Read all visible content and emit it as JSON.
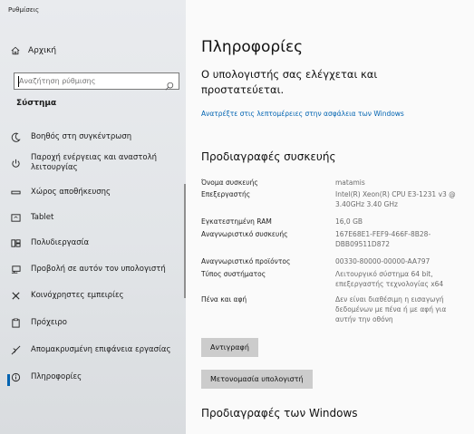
{
  "window": {
    "title": "Ρυθμίσεις"
  },
  "sidebar": {
    "home_label": "Αρχική",
    "search_placeholder": "Αναζήτηση ρύθμισης",
    "section_label": "Σύστημα",
    "items": [
      {
        "label": "Βοηθός στη συγκέντρωση",
        "icon": "moon-icon"
      },
      {
        "label": "Παροχή ενέργειας και αναστολή λειτουργίας",
        "icon": "power-icon"
      },
      {
        "label": "Χώρος αποθήκευσης",
        "icon": "storage-icon"
      },
      {
        "label": "Tablet",
        "icon": "tablet-icon"
      },
      {
        "label": "Πολυδιεργασία",
        "icon": "multitasking-icon"
      },
      {
        "label": "Προβολή σε αυτόν τον υπολογιστή",
        "icon": "projecting-icon"
      },
      {
        "label": "Κοινόχρηστες εμπειρίες",
        "icon": "shared-experiences-icon"
      },
      {
        "label": "Πρόχειρο",
        "icon": "clipboard-icon"
      },
      {
        "label": "Απομακρυσμένη επιφάνεια εργασίας",
        "icon": "remote-desktop-icon"
      },
      {
        "label": "Πληροφορίες",
        "icon": "info-icon",
        "selected": true
      }
    ]
  },
  "main": {
    "title": "Πληροφορίες",
    "protection_status": "Ο υπολογιστής σας ελέγχεται και προστατεύεται.",
    "security_link": "Ανατρέξτε στις λεπτομέρειες στην ασφάλεια των Windows",
    "device_specs_heading": "Προδιαγραφές συσκευής",
    "specs": [
      {
        "key": "Όνομα συσκευής",
        "value": "matamis"
      },
      {
        "key": "Επεξεργαστής",
        "value": "Intel(R) Xeon(R) CPU E3-1231 v3 @ 3.40GHz   3.40 GHz"
      },
      {
        "key": "Εγκατεστημένη RAM",
        "value": "16,0 GB"
      },
      {
        "key": "Αναγνωριστικό συσκευής",
        "value": "167E68E1-FEF9-466F-8B28-DBB09511D872"
      },
      {
        "key": "Αναγνωριστικό προϊόντος",
        "value": "00330-80000-00000-AA797"
      },
      {
        "key": "Τύπος συστήματος",
        "value": "Λειτουργικό σύστημα 64 bit, επεξεργαστής τεχνολογίας x64"
      },
      {
        "key": "Πένα και αφή",
        "value": "Δεν είναι διαθέσιμη η εισαγωγή δεδομένων με πένα ή με αφή για αυτήν την οθόνη"
      }
    ],
    "copy_button": "Αντιγραφή",
    "rename_button": "Μετονομασία υπολογιστή",
    "windows_specs_heading": "Προδιαγραφές των Windows"
  },
  "colors": {
    "accent": "#0063b1",
    "button_bg": "#cccccc",
    "sidebar_bg": "#e6e8ea",
    "main_bg": "#fafafa"
  }
}
